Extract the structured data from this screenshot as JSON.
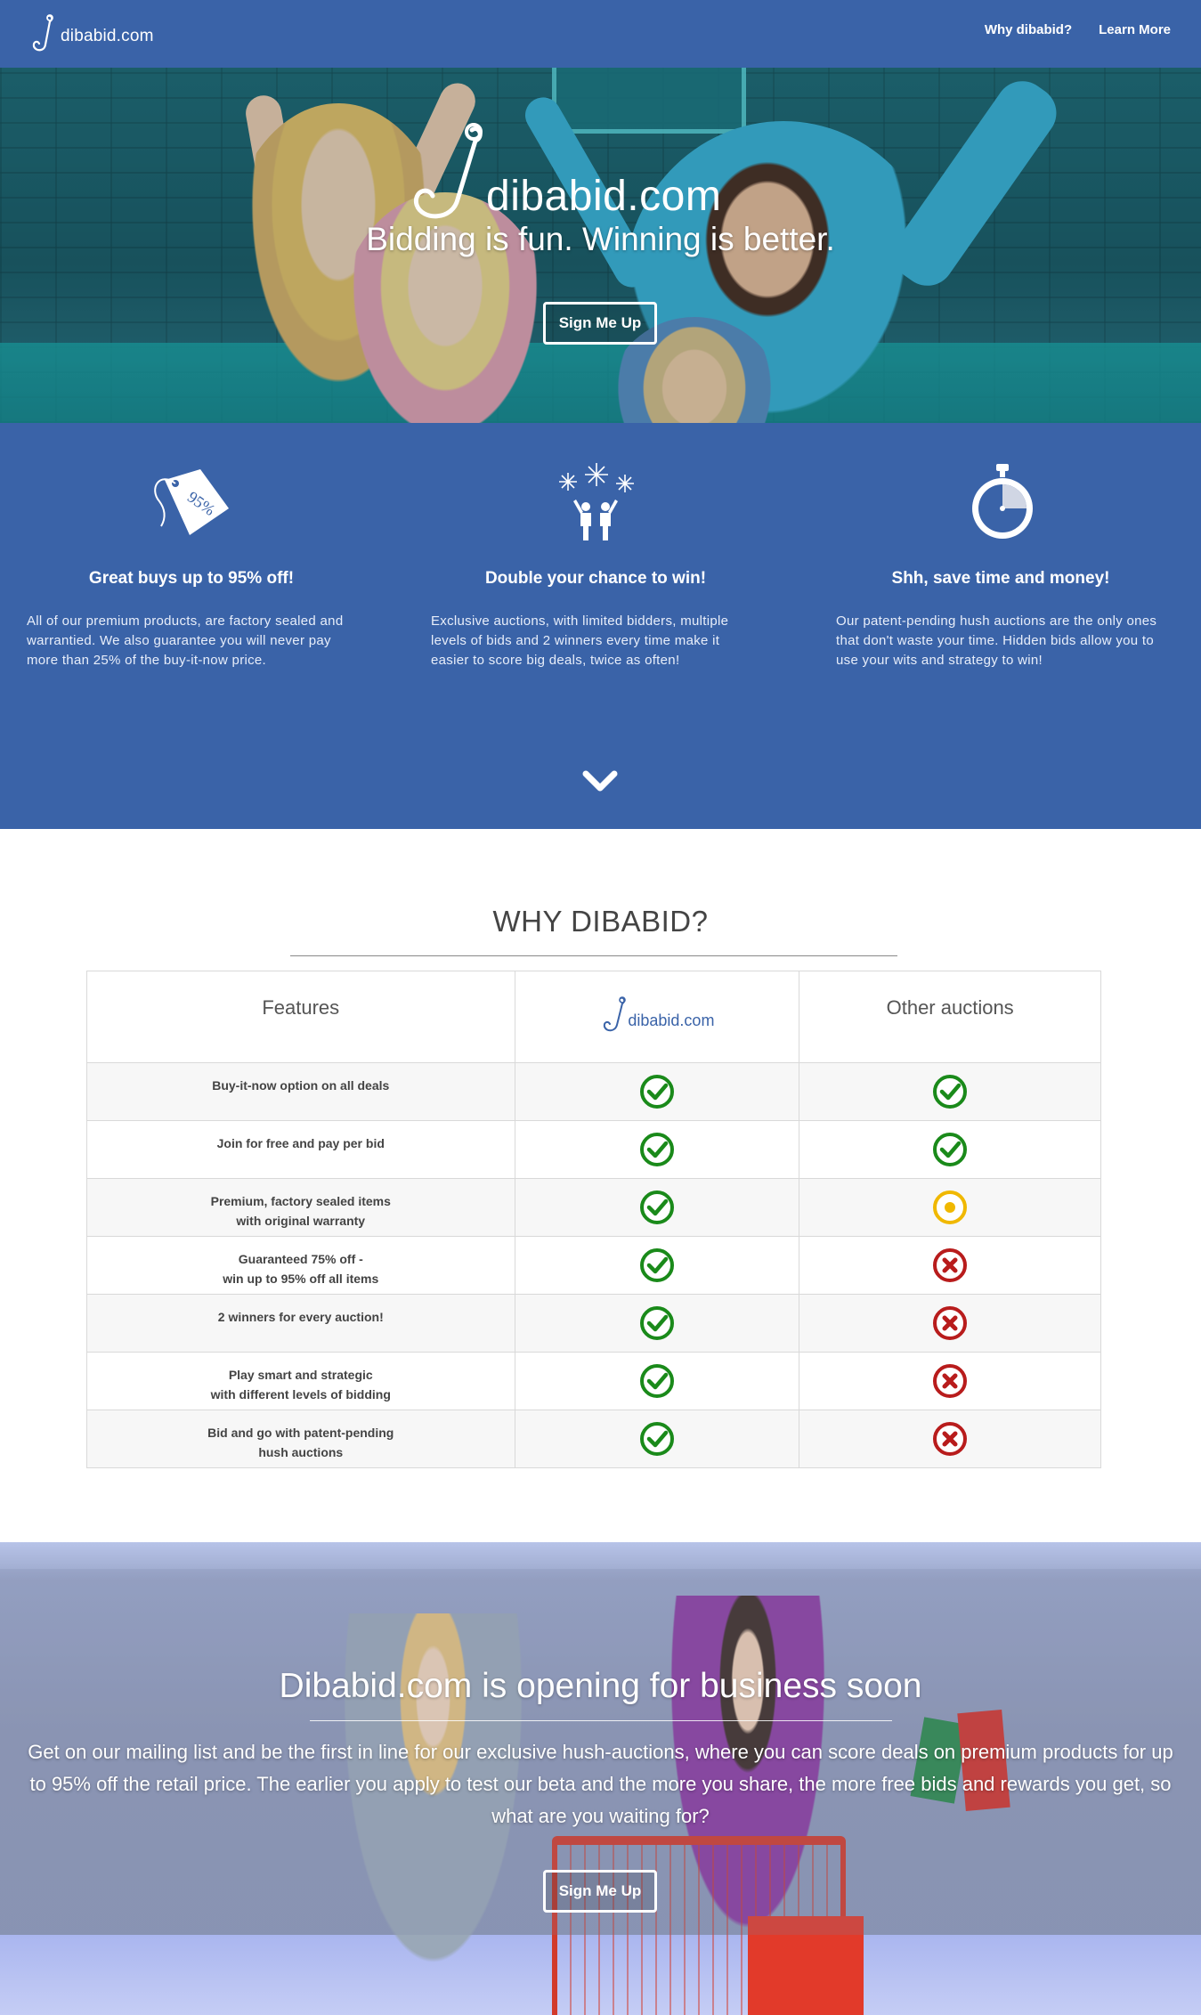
{
  "nav": {
    "brand": "dibabid.com",
    "links": [
      "Why dibabid?",
      "Learn More"
    ]
  },
  "hero": {
    "brand": "dibabid.com",
    "tagline": "Bidding is fun. Winning is better.",
    "cta": "Sign Me Up"
  },
  "features": [
    {
      "title": "Great buys up to 95% off!",
      "text": "All of our premium products, are factory sealed and warrantied. We also guarantee you will never pay more than 25% of the buy-it-now price.",
      "icon": "price-tag-icon",
      "tag_label": "95%"
    },
    {
      "title": "Double your chance to win!",
      "text": "Exclusive auctions, with limited bidders, multiple levels of bids and 2 winners every time make it easier to score big deals, twice as often!",
      "icon": "celebrating-people-icon"
    },
    {
      "title": "Shh, save time and money!",
      "text": "Our patent-pending hush auctions are the only ones that don't waste your time. Hidden bids allow you to use your wits and strategy to win!",
      "icon": "stopwatch-icon"
    }
  ],
  "why": {
    "title": "WHY DIBABID?",
    "headers": {
      "features": "Features",
      "dibabid": "dibabid.com",
      "other": "Other auctions"
    },
    "rows": [
      {
        "feature": [
          "Buy-it-now option on all deals"
        ],
        "dibabid": "check",
        "other": "check"
      },
      {
        "feature": [
          "Join for free and pay per bid"
        ],
        "dibabid": "check",
        "other": "check"
      },
      {
        "feature": [
          "Premium, factory sealed items",
          "with original warranty"
        ],
        "dibabid": "check",
        "other": "partial"
      },
      {
        "feature": [
          "Guaranteed 75% off -",
          "win up to 95% off all items"
        ],
        "dibabid": "check",
        "other": "cross"
      },
      {
        "feature": [
          "2 winners for every auction!"
        ],
        "dibabid": "check",
        "other": "cross"
      },
      {
        "feature": [
          "Play smart and strategic",
          "with different levels of bidding"
        ],
        "dibabid": "check",
        "other": "cross"
      },
      {
        "feature": [
          "Bid and go with patent-pending",
          "hush auctions"
        ],
        "dibabid": "check",
        "other": "cross"
      }
    ]
  },
  "signup": {
    "title": "Dibabid.com is opening for business soon",
    "text": "Get on our mailing list and be the first in line for our exclusive hush-auctions, where you can score deals on premium products for up to 95% off the retail price. The earlier you apply to test our beta and the more you share, the more free bids and rewards you get, so what are you waiting for?",
    "cta": "Sign Me Up"
  },
  "colors": {
    "brand_blue": "#3a63a8",
    "check_green": "#1a8a1a",
    "partial_yellow": "#f0b800",
    "cross_red": "#b81c1c"
  }
}
